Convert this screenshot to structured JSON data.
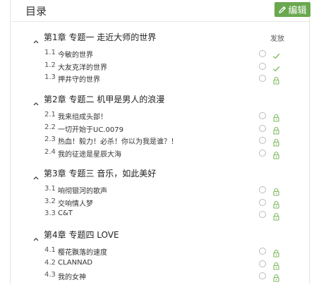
{
  "header": {
    "title": "目录",
    "edit_label": "编辑"
  },
  "status_header": "发放",
  "colors": {
    "accent": "#6aa84f",
    "icon_green": "#7ab85a"
  },
  "chapters": [
    {
      "title": "第1章 专题一 走近大师的世界",
      "lessons": [
        {
          "num": "1.1",
          "title": "今敏的世界",
          "status": "check-icon"
        },
        {
          "num": "1.2",
          "title": "大友克洋的世界",
          "status": "check-icon"
        },
        {
          "num": "1.3",
          "title": "押井守的世界",
          "status": "lock-icon"
        }
      ]
    },
    {
      "title": "第2章 专题二 机甲是男人的浪漫",
      "lessons": [
        {
          "num": "2.1",
          "title": "我来组成头部！",
          "status": "lock-icon"
        },
        {
          "num": "2.2",
          "title": "一切开始于UC.0079",
          "status": "lock-icon"
        },
        {
          "num": "2.3",
          "title": "热血！毅力！必杀！你以为我是谁？！",
          "status": "lock-icon"
        },
        {
          "num": "2.4",
          "title": "我的征途是星辰大海",
          "status": "lock-icon"
        }
      ]
    },
    {
      "title": "第3章 专题三 音乐，如此美好",
      "lessons": [
        {
          "num": "3.1",
          "title": "响彻银河的歌声",
          "status": "lock-icon"
        },
        {
          "num": "3.2",
          "title": "交响情人梦",
          "status": "lock-icon"
        },
        {
          "num": "3.3",
          "title": "C&T",
          "status": "lock-icon"
        }
      ]
    },
    {
      "title": "第4章 专题四 LOVE",
      "lessons": [
        {
          "num": "4.1",
          "title": "樱花飘落的速度",
          "status": "lock-icon"
        },
        {
          "num": "4.2",
          "title": "CLANNAD",
          "status": "lock-icon"
        },
        {
          "num": "4.3",
          "title": "我的女神",
          "status": "lock-icon"
        }
      ]
    }
  ]
}
